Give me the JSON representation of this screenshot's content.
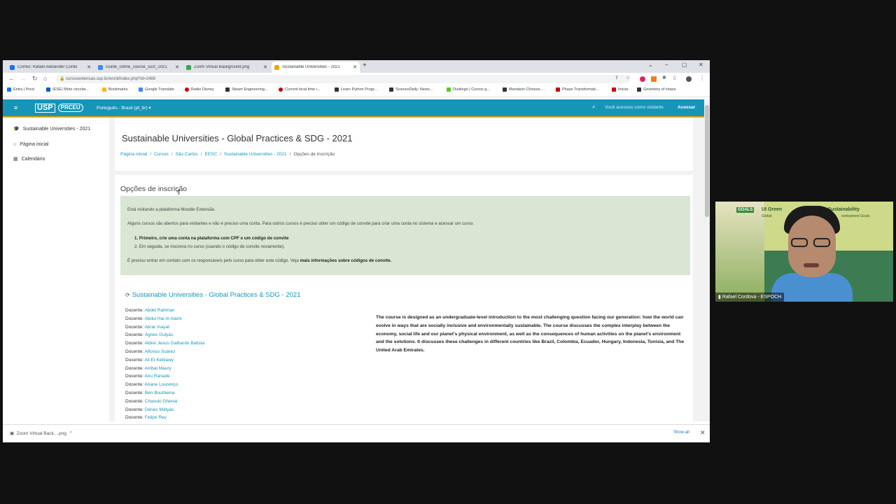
{
  "browser": {
    "tabs": [
      {
        "title": "Correo: Rafael Alexander Cordo",
        "color": "#1a73e8",
        "active": false
      },
      {
        "title": "Guide_online_course_sust_2021",
        "color": "#4285f4",
        "active": false
      },
      {
        "title": "Zoom Virtual Background.png",
        "color": "#34a853",
        "active": false
      },
      {
        "title": "Sustainable Universities - 2021",
        "color": "#f0a500",
        "active": true
      }
    ],
    "new_tab": "+",
    "url": "cursosextensao.usp.br/enrol/index.php?id=2488",
    "bookmarks": [
      {
        "label": "Entra | Prezi",
        "color": "#1a73e8"
      },
      {
        "label": "(ESE) Moto circolar...",
        "color": "#0a58ca"
      },
      {
        "label": "Bookmarks",
        "color": "#fbbc04"
      },
      {
        "label": "Google Translate",
        "color": "#4285f4"
      },
      {
        "label": "Radio Disney",
        "color": "#c00"
      },
      {
        "label": "Steam Engineering...",
        "color": "#333"
      },
      {
        "label": "Current local time i...",
        "color": "#c00"
      },
      {
        "label": "Learn Python Progr...",
        "color": "#333"
      },
      {
        "label": "ScienceDaily: News...",
        "color": "#333"
      },
      {
        "label": "Duolingo | Cursos g...",
        "color": "#58cc02"
      },
      {
        "label": "Mandarin Chinese...",
        "color": "#333"
      },
      {
        "label": "Phase Transformati...",
        "color": "#c00"
      },
      {
        "label": "Iniciar",
        "color": "#c00"
      },
      {
        "label": "Geometry of chaos",
        "color": "#333"
      }
    ]
  },
  "moodle": {
    "logo_usp": "USP",
    "logo_prceu": "PRCEU",
    "language": "Português - Brasil (pt_br) ▾",
    "visitor_text": "Você acessou como visitante",
    "login_label": "Acessar",
    "sidebar": [
      {
        "icon": "🎓",
        "label": "Sustainable Universities - 2021"
      },
      {
        "icon": "⌂",
        "label": "Página inicial"
      },
      {
        "icon": "▦",
        "label": "Calendário"
      }
    ],
    "page_title": "Sustainable Universities - Global Practices & SDG - 2021",
    "breadcrumbs": [
      "Página inicial",
      "Cursos",
      "São Carlos",
      "EESC",
      "Sustainable Universities - 2021",
      "Opções de inscrição"
    ],
    "section_title": "Opções de inscrição",
    "info": {
      "line1": "Está visitando a plataforma Moodle Extensão.",
      "line2": "Alguns cursos são abertos para visitantes e não é preciso uma conta. Para outros cursos é preciso obter um código de convite para criar uma conta no sistema e acessar um curso.",
      "step1": "1.  Primeiro, crie uma conta na plataforma com CPF e um código de convite",
      "step2": "2.  Em seguida, se inscreva no curso (usando o código de convite novamente).",
      "line3_pre": "É preciso entrar em contato com os responsáveis pelo curso para obter este código. Veja ",
      "line3_bold": "mais informações sobre códigos de convite."
    },
    "course_title": "Sustainable Universities - Global Practices & SDG - 2021",
    "teacher_label": "Docente: ",
    "teachers": [
      "Abdel Rahman",
      "Abdul Hai Al Alami",
      "Abrar Inayat",
      "Ágnes Gulyás",
      "Aldrei Jesus Galhardo Batista",
      "Alfonso Suárez",
      "Ali El-Keblawy",
      "Aníbal Maury",
      "Anu Ranade",
      "Ariane Lourenço",
      "Ben Boutheina",
      "Chaouki Ghenai",
      "Dénes Mátyás",
      "Felipe Rey"
    ],
    "summary": "The course is designed as an undergraduate-level introduction to the most challenging question facing our generation: how the world can evolve in ways that are socially inclusive and environmentally sustainable. The course discusses the complex interplay between the economy, social life and our planet's physical environment, as well as the consequences of human activities on the planet's environment and the solutions. It discusses these challenges in different countries like Brazil, Colombia, Ecuador, Hungary, Indonesia, Tunisia, and The United Arab Emirates."
  },
  "downloads": {
    "file": "Zoom Virtual Back....png",
    "show_all": "Show all"
  },
  "webcam": {
    "name": "Rafael Cordova - ESPOCH",
    "sign_goals": "GOALS",
    "sign_line1": "UI Green",
    "sign_line2": "on Sustainability",
    "sign_sub1": "Global",
    "sign_sub2": "evelopment Goals"
  },
  "colors": {
    "moodle_header": "#1596b8",
    "accent_orange": "#f0a500",
    "info_box": "#d9e6d3"
  }
}
